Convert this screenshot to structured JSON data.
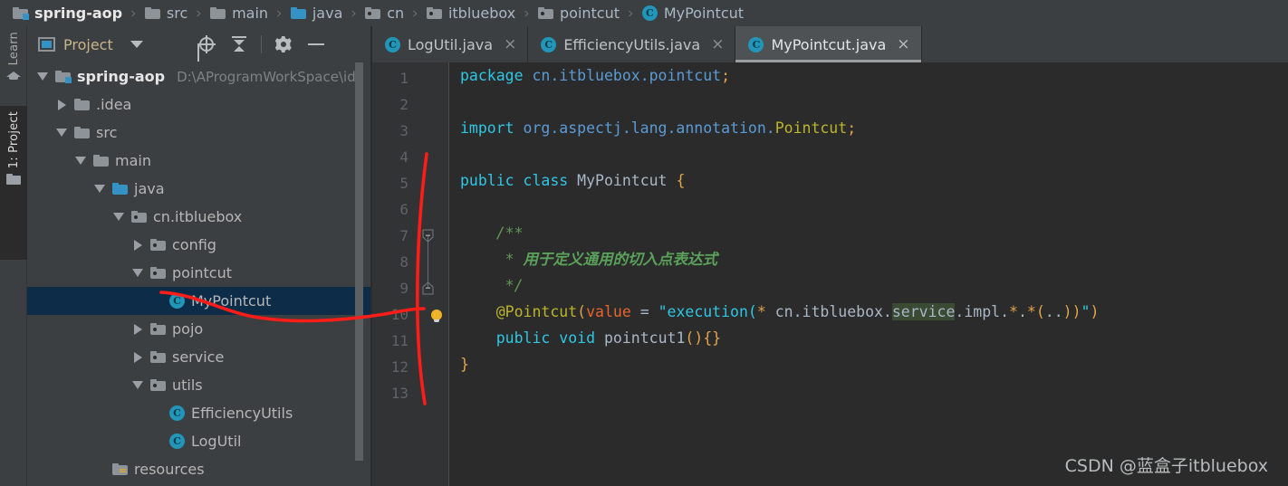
{
  "breadcrumb": {
    "items": [
      {
        "label": "spring-aop",
        "icon": "module-folder-icon"
      },
      {
        "label": "src",
        "icon": "folder-icon"
      },
      {
        "label": "main",
        "icon": "folder-icon"
      },
      {
        "label": "java",
        "icon": "source-folder-icon"
      },
      {
        "label": "cn",
        "icon": "package-icon"
      },
      {
        "label": "itbluebox",
        "icon": "package-icon"
      },
      {
        "label": "pointcut",
        "icon": "package-icon"
      },
      {
        "label": "MyPointcut",
        "icon": "class-icon"
      }
    ],
    "separator": "›"
  },
  "tool_strip": {
    "tabs": [
      {
        "label": "Learn",
        "icon": "graduation-cap-icon",
        "active": false
      },
      {
        "label": "1: Project",
        "icon": "folder-icon",
        "active": true
      }
    ]
  },
  "project_panel": {
    "title": "Project",
    "title_caret": "▼",
    "toolbar_buttons": [
      {
        "name": "select-opened-file-button",
        "icon": "crosshair-target-icon"
      },
      {
        "name": "collapse-all-button",
        "icon": "collapse-all-icon"
      },
      {
        "name": "settings-button",
        "icon": "gear-icon"
      },
      {
        "name": "hide-button",
        "icon": "minus-icon"
      }
    ],
    "tree": [
      {
        "indent": 0,
        "twisty": "down",
        "icon": "module-folder-icon",
        "label": "spring-aop",
        "path": "D:\\AProgramWorkSpace\\id",
        "bold": true,
        "selected": false
      },
      {
        "indent": 1,
        "twisty": "right",
        "icon": "folder-icon",
        "label": ".idea",
        "path": "",
        "bold": false,
        "selected": false
      },
      {
        "indent": 1,
        "twisty": "down",
        "icon": "folder-icon",
        "label": "src",
        "path": "",
        "bold": false,
        "selected": false
      },
      {
        "indent": 2,
        "twisty": "down",
        "icon": "folder-icon",
        "label": "main",
        "path": "",
        "bold": false,
        "selected": false
      },
      {
        "indent": 3,
        "twisty": "down",
        "icon": "source-folder-icon",
        "label": "java",
        "path": "",
        "bold": false,
        "selected": false
      },
      {
        "indent": 4,
        "twisty": "down",
        "icon": "package-icon",
        "label": "cn.itbluebox",
        "path": "",
        "bold": false,
        "selected": false
      },
      {
        "indent": 5,
        "twisty": "right",
        "icon": "package-icon",
        "label": "config",
        "path": "",
        "bold": false,
        "selected": false
      },
      {
        "indent": 5,
        "twisty": "down",
        "icon": "package-icon",
        "label": "pointcut",
        "path": "",
        "bold": false,
        "selected": false
      },
      {
        "indent": 6,
        "twisty": "none",
        "icon": "class-icon",
        "label": "MyPointcut",
        "path": "",
        "bold": false,
        "selected": true
      },
      {
        "indent": 5,
        "twisty": "right",
        "icon": "package-icon",
        "label": "pojo",
        "path": "",
        "bold": false,
        "selected": false
      },
      {
        "indent": 5,
        "twisty": "right",
        "icon": "package-icon",
        "label": "service",
        "path": "",
        "bold": false,
        "selected": false
      },
      {
        "indent": 5,
        "twisty": "down",
        "icon": "package-icon",
        "label": "utils",
        "path": "",
        "bold": false,
        "selected": false
      },
      {
        "indent": 6,
        "twisty": "none",
        "icon": "class-icon",
        "label": "EfficiencyUtils",
        "path": "",
        "bold": false,
        "selected": false
      },
      {
        "indent": 6,
        "twisty": "none",
        "icon": "class-icon",
        "label": "LogUtil",
        "path": "",
        "bold": false,
        "selected": false
      },
      {
        "indent": 3,
        "twisty": "none",
        "icon": "resources-folder-icon",
        "label": "resources",
        "path": "",
        "bold": false,
        "selected": false
      }
    ]
  },
  "editor": {
    "tabs": [
      {
        "label": "LogUtil.java",
        "icon": "class-icon",
        "close": "×",
        "active": false
      },
      {
        "label": "EfficiencyUtils.java",
        "icon": "class-icon",
        "close": "×",
        "active": false
      },
      {
        "label": "MyPointcut.java",
        "icon": "class-icon",
        "close": "×",
        "active": true
      }
    ],
    "line_numbers": [
      "1",
      "2",
      "3",
      "4",
      "5",
      "6",
      "7",
      "8",
      "9",
      "10",
      "11",
      "12",
      "13"
    ],
    "lines": [
      {
        "n": 1,
        "tokens": [
          {
            "t": "package",
            "c": "kw2"
          },
          {
            "t": " ",
            "c": "id"
          },
          {
            "t": "cn.itbluebox.pointcut",
            "c": "pkg2"
          },
          {
            "t": ";",
            "c": "punc"
          }
        ]
      },
      {
        "n": 2,
        "tokens": []
      },
      {
        "n": 3,
        "tokens": [
          {
            "t": "import",
            "c": "kw2"
          },
          {
            "t": " ",
            "c": "id"
          },
          {
            "t": "org.aspectj.lang.annotation.",
            "c": "pkg2"
          },
          {
            "t": "Pointcut",
            "c": "ann"
          },
          {
            "t": ";",
            "c": "punc"
          }
        ]
      },
      {
        "n": 4,
        "tokens": []
      },
      {
        "n": 5,
        "tokens": [
          {
            "t": "public class",
            "c": "kw2"
          },
          {
            "t": " ",
            "c": "id"
          },
          {
            "t": "MyPointcut",
            "c": "id"
          },
          {
            "t": " ",
            "c": "id"
          },
          {
            "t": "{",
            "c": "brace"
          }
        ]
      },
      {
        "n": 6,
        "tokens": []
      },
      {
        "n": 7,
        "tokens": [
          {
            "t": "    /**",
            "c": "cmt"
          }
        ]
      },
      {
        "n": 8,
        "tokens": [
          {
            "t": "     * ",
            "c": "cmt"
          },
          {
            "t": "用于定义通用的切入点表达式",
            "c": "cmtb"
          }
        ]
      },
      {
        "n": 9,
        "tokens": [
          {
            "t": "     */",
            "c": "cmt"
          }
        ]
      },
      {
        "n": 10,
        "tokens": [
          {
            "t": "    ",
            "c": "id"
          },
          {
            "t": "@Pointcut",
            "c": "ann"
          },
          {
            "t": "(",
            "c": "punc"
          },
          {
            "t": "value",
            "c": "val"
          },
          {
            "t": " = ",
            "c": "id"
          },
          {
            "t": "\"execution(",
            "c": "str"
          },
          {
            "t": "*",
            "c": "punc"
          },
          {
            "t": " cn.itbluebox.",
            "c": "id"
          },
          {
            "t": "service",
            "c": "id hl"
          },
          {
            "t": ".impl.",
            "c": "id"
          },
          {
            "t": "*",
            "c": "punc"
          },
          {
            "t": ".",
            "c": "id"
          },
          {
            "t": "*",
            "c": "punc"
          },
          {
            "t": "(",
            "c": "punc"
          },
          {
            "t": "..",
            "c": "id"
          },
          {
            "t": "))",
            "c": "punc"
          },
          {
            "t": "\"",
            "c": "str"
          },
          {
            "t": ")",
            "c": "punc"
          }
        ]
      },
      {
        "n": 11,
        "tokens": [
          {
            "t": "    ",
            "c": "id"
          },
          {
            "t": "public void",
            "c": "kw2"
          },
          {
            "t": " ",
            "c": "id"
          },
          {
            "t": "pointcut1",
            "c": "id"
          },
          {
            "t": "()",
            "c": "punc"
          },
          {
            "t": "{}",
            "c": "brace"
          }
        ]
      },
      {
        "n": 12,
        "tokens": [
          {
            "t": "}",
            "c": "brace"
          }
        ]
      },
      {
        "n": 13,
        "tokens": []
      }
    ],
    "fold_markers": [
      {
        "line": 7,
        "type": "fold-start"
      },
      {
        "line": 9,
        "type": "fold-end"
      }
    ],
    "bulb_line": 10,
    "bulb_icon": "lightbulb-intention-icon"
  },
  "annotations": {
    "color": "#fc1c18",
    "marks": [
      "underline-mypointcut-squiggle",
      "vertical-gutter-line"
    ]
  },
  "watermark": {
    "text": "CSDN @蓝盒子itbluebox"
  },
  "colors": {
    "window_bg": "#3c3f41",
    "editor_bg": "#2b2b2b",
    "gutter_bg": "#313335",
    "selection_bg": "#0d2c47",
    "accent": "#3592c4",
    "annotation_red": "#fc1c18"
  }
}
